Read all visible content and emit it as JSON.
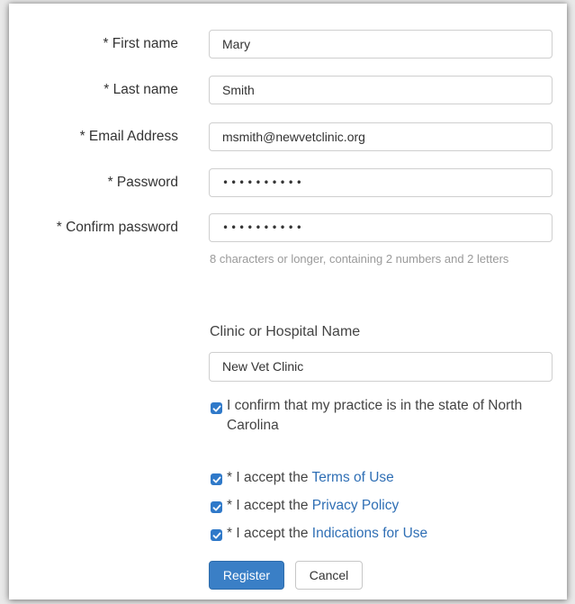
{
  "form": {
    "fields": [
      {
        "label": "* First name",
        "value": "Mary"
      },
      {
        "label": "* Last name",
        "value": "Smith"
      },
      {
        "label": "* Email Address",
        "value": "msmith@newvetclinic.org"
      },
      {
        "label": "* Password",
        "value": "••••••••••"
      },
      {
        "label": "* Confirm password",
        "value": "••••••••••"
      }
    ],
    "password_hint": "8 characters or longer, containing 2 numbers and 2 letters",
    "clinic": {
      "label": "Clinic or Hospital Name",
      "value": "New Vet Clinic"
    },
    "state_confirm": {
      "checked": true,
      "text": "I confirm that my practice is in the state of North Carolina"
    },
    "accept": [
      {
        "checked": true,
        "prefix": "* I accept the ",
        "link": "Terms of Use"
      },
      {
        "checked": true,
        "prefix": "* I accept the ",
        "link": "Privacy Policy"
      },
      {
        "checked": true,
        "prefix": "* I accept the ",
        "link": "Indications for Use"
      }
    ],
    "buttons": {
      "register": "Register",
      "cancel": "Cancel"
    }
  },
  "colors": {
    "accent": "#3a7fc6",
    "link": "#2f6fb5",
    "hint": "#9a9a9a"
  }
}
